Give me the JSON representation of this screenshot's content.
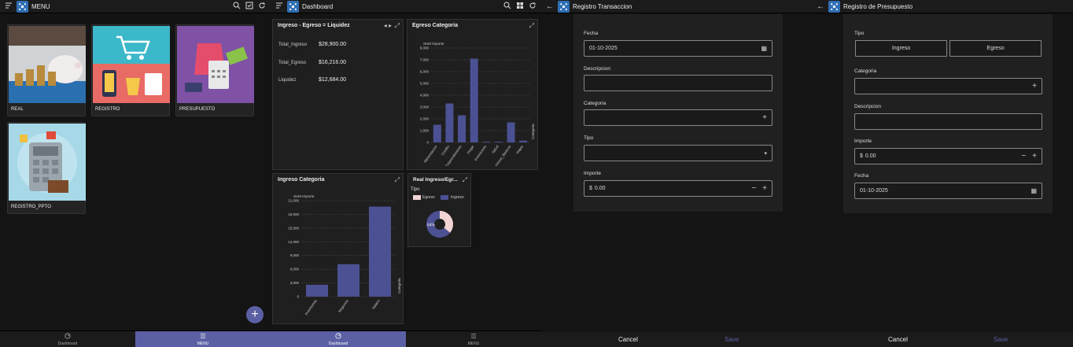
{
  "menu_panel": {
    "title": "MENU",
    "tiles": [
      {
        "label": "REAL"
      },
      {
        "label": "REGISTRO"
      },
      {
        "label": "PRESUPUESTO"
      },
      {
        "label": "REGISTRO_PPTO"
      }
    ],
    "fab_label": "+",
    "bottom_nav": {
      "dashboard": "Dashboard",
      "menu": "MENU"
    }
  },
  "dashboard_panel": {
    "title": "Dashboard",
    "kpi_card": {
      "title": "Ingreso - Egreso = Liquidez",
      "rows": [
        {
          "label": "Total_Ingreso",
          "value": "$28,900.00"
        },
        {
          "label": "Total_Egreso",
          "value": "$16,216.00"
        },
        {
          "label": "Liquidez",
          "value": "$12,684.00"
        }
      ]
    },
    "donut_card": {
      "title": "Real Ingreso/Egr...",
      "legend_title": "Tipo",
      "legend": [
        "Egreso",
        "Ingreso"
      ],
      "pct_left": "64%"
    },
    "bottom_nav": {
      "dashboard": "Dashboard",
      "menu": "MENU"
    }
  },
  "chart_data": [
    {
      "type": "bar",
      "title": "Egreso Categoria",
      "ylabel": "SUM Importe",
      "xlabel": "Categoria",
      "categories": [
        "Alimentacion",
        "Credito",
        "Emprendimiento",
        "Hogar",
        "Inversiones",
        "Salud",
        "Servicios_Basicos",
        "Viajes"
      ],
      "values": [
        1500,
        3300,
        2300,
        7100,
        60,
        60,
        1700,
        150
      ],
      "ylim": [
        0,
        8000
      ],
      "yticks": [
        "0",
        "1,000",
        "2,000",
        "3,000",
        "4,000",
        "5,000",
        "6,000",
        "7,000",
        "8,000"
      ],
      "grid": true
    },
    {
      "type": "bar",
      "title": "Ingreso Categoria",
      "ylabel": "SUM Importe",
      "xlabel": "Categoria",
      "categories": [
        "Inversiones",
        "Negocios",
        "Salario"
      ],
      "values": [
        2600,
        7100,
        19700
      ],
      "ylim": [
        0,
        21000
      ],
      "yticks": [
        "0",
        "3,000",
        "6,000",
        "9,000",
        "12,000",
        "15,000",
        "18,000",
        "21,000"
      ],
      "grid": true
    },
    {
      "type": "pie",
      "title": "Real Ingreso/Egr...",
      "categories": [
        "Egreso",
        "Ingreso"
      ],
      "values": [
        36,
        64
      ]
    }
  ],
  "registro_panel": {
    "title": "Registro Transaccion",
    "fecha_label": "Fecha",
    "fecha_value": "01-10-2025",
    "descripcion_label": "Descripcion",
    "categoria_label": "Categoria",
    "tipo_label": "Tipo",
    "importe_label": "Importe",
    "importe_currency": "$",
    "importe_value": "0.00",
    "cancel": "Cancel",
    "save": "Save"
  },
  "presupuesto_panel": {
    "title": "Registro de Presupuesto",
    "tipo_label": "Tipo",
    "tipo_options": [
      "Ingreso",
      "Egreso"
    ],
    "categoria_label": "Categoria",
    "descripcion_label": "Descripcion",
    "importe_label": "Importe",
    "importe_currency": "$",
    "importe_value": "0.00",
    "fecha_label": "Fecha",
    "fecha_value": "01-10-2025",
    "cancel": "Cancel",
    "save": "Save"
  },
  "colors": {
    "accent": "#5b5fa3",
    "bar": "#4b5192",
    "egreso": "#f2d4d4",
    "ingreso": "#4b5192"
  }
}
